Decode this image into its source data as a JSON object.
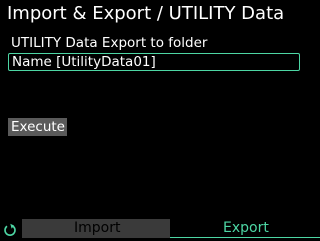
{
  "header": {
    "title": "Import & Export / UTILITY Data"
  },
  "main": {
    "subtitle": "UTILITY Data Export to folder",
    "name_field": {
      "value": "Name [UtilityData01]"
    },
    "execute_label": "Execute"
  },
  "tabs": [
    {
      "label": "Import",
      "active": false
    },
    {
      "label": "Export",
      "active": true
    }
  ],
  "icons": {
    "refresh": "refresh-icon"
  },
  "colors": {
    "accent": "#4dd6a4",
    "background": "#000000",
    "button": "#5a5a5a",
    "inactive_tab": "#3a3a3a"
  }
}
